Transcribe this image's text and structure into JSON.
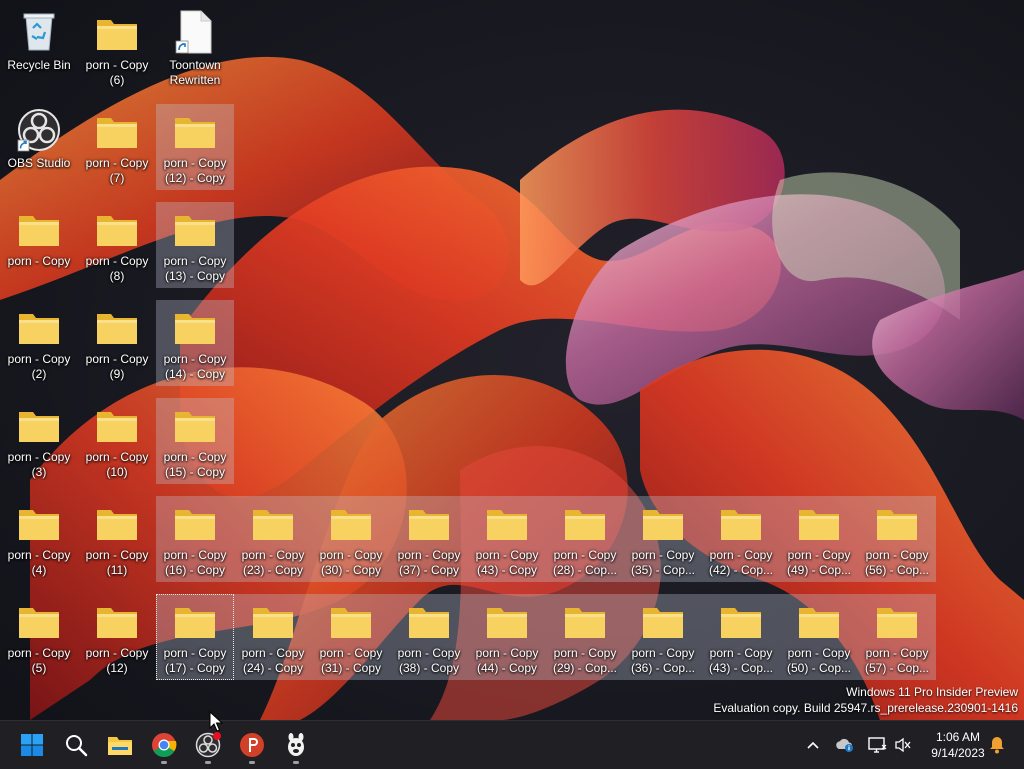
{
  "desktop": {
    "icons": [
      {
        "label": "Recycle Bin",
        "icon": "recycle-bin-icon"
      },
      {
        "label": "porn - Copy\n(6)",
        "icon": "folder-icon"
      },
      {
        "label": "Toontown\nRewritten",
        "icon": "shortcut-file-icon"
      },
      {
        "label": "OBS Studio",
        "icon": "obs-studio-icon"
      },
      {
        "label": "porn - Copy\n(7)",
        "icon": "folder-icon"
      },
      {
        "label": "porn - Copy\n(12) - Copy",
        "icon": "folder-icon"
      },
      {
        "label": "porn - Copy",
        "icon": "folder-icon"
      },
      {
        "label": "porn - Copy\n(8)",
        "icon": "folder-icon"
      },
      {
        "label": "porn - Copy\n(13) - Copy",
        "icon": "folder-icon"
      },
      {
        "label": "porn - Copy\n(2)",
        "icon": "folder-icon"
      },
      {
        "label": "porn - Copy\n(9)",
        "icon": "folder-icon"
      },
      {
        "label": "porn - Copy\n(14) - Copy",
        "icon": "folder-icon"
      },
      {
        "label": "porn - Copy\n(3)",
        "icon": "folder-icon"
      },
      {
        "label": "porn - Copy\n(10)",
        "icon": "folder-icon"
      },
      {
        "label": "porn - Copy\n(15) - Copy",
        "icon": "folder-icon"
      },
      {
        "label": "porn - Copy\n(4)",
        "icon": "folder-icon"
      },
      {
        "label": "porn - Copy\n(11)",
        "icon": "folder-icon"
      },
      {
        "label": "porn - Copy\n(16) - Copy",
        "icon": "folder-icon"
      },
      {
        "label": "porn - Copy\n(23) - Copy",
        "icon": "folder-icon"
      },
      {
        "label": "porn - Copy\n(30) - Copy",
        "icon": "folder-icon"
      },
      {
        "label": "porn - Copy\n(37) - Copy",
        "icon": "folder-icon"
      },
      {
        "label": "porn - Copy\n(43) - Copy",
        "icon": "folder-icon"
      },
      {
        "label": "porn - Copy\n(28) - Cop...",
        "icon": "folder-icon"
      },
      {
        "label": "porn - Copy\n(35) - Cop...",
        "icon": "folder-icon"
      },
      {
        "label": "porn - Copy\n(42) - Cop...",
        "icon": "folder-icon"
      },
      {
        "label": "porn - Copy\n(49) - Cop...",
        "icon": "folder-icon"
      },
      {
        "label": "porn - Copy\n(56) - Cop...",
        "icon": "folder-icon"
      },
      {
        "label": "porn - Copy\n(5)",
        "icon": "folder-icon"
      },
      {
        "label": "porn - Copy\n(12)",
        "icon": "folder-icon"
      },
      {
        "label": "porn - Copy\n(17) - Copy",
        "icon": "folder-icon"
      },
      {
        "label": "porn - Copy\n(24) - Copy",
        "icon": "folder-icon"
      },
      {
        "label": "porn - Copy\n(31) - Copy",
        "icon": "folder-icon"
      },
      {
        "label": "porn - Copy\n(38) - Copy",
        "icon": "folder-icon"
      },
      {
        "label": "porn - Copy\n(44) - Copy",
        "icon": "folder-icon"
      },
      {
        "label": "porn - Copy\n(29) - Cop...",
        "icon": "folder-icon"
      },
      {
        "label": "porn - Copy\n(36) - Cop...",
        "icon": "folder-icon"
      },
      {
        "label": "porn - Copy\n(43) - Cop...",
        "icon": "folder-icon"
      },
      {
        "label": "porn - Copy\n(50) - Cop...",
        "icon": "folder-icon"
      },
      {
        "label": "porn - Copy\n(57) - Cop...",
        "icon": "folder-icon"
      }
    ]
  },
  "watermark": {
    "line1": "Windows 11 Pro Insider Preview",
    "line2": "Evaluation copy. Build 25947.rs_prerelease.230901-1416"
  },
  "taskbar": {
    "apps": [
      {
        "name": "windows-start-icon"
      },
      {
        "name": "search-icon"
      },
      {
        "name": "file-explorer-icon"
      },
      {
        "name": "chrome-icon"
      },
      {
        "name": "obs-studio-icon"
      },
      {
        "name": "psiphon-icon"
      },
      {
        "name": "toontown-icon"
      }
    ],
    "tray": {
      "icons": [
        "chevron-up-icon",
        "onedrive-icon",
        "network-icon",
        "volume-muted-icon"
      ],
      "time": "1:06 AM",
      "date": "9/14/2023",
      "notification_icon": "bell-icon"
    }
  },
  "colors": {
    "taskbar_bg": "#1f1f24",
    "folder": "#f5c842",
    "accent": "#0078d4"
  }
}
